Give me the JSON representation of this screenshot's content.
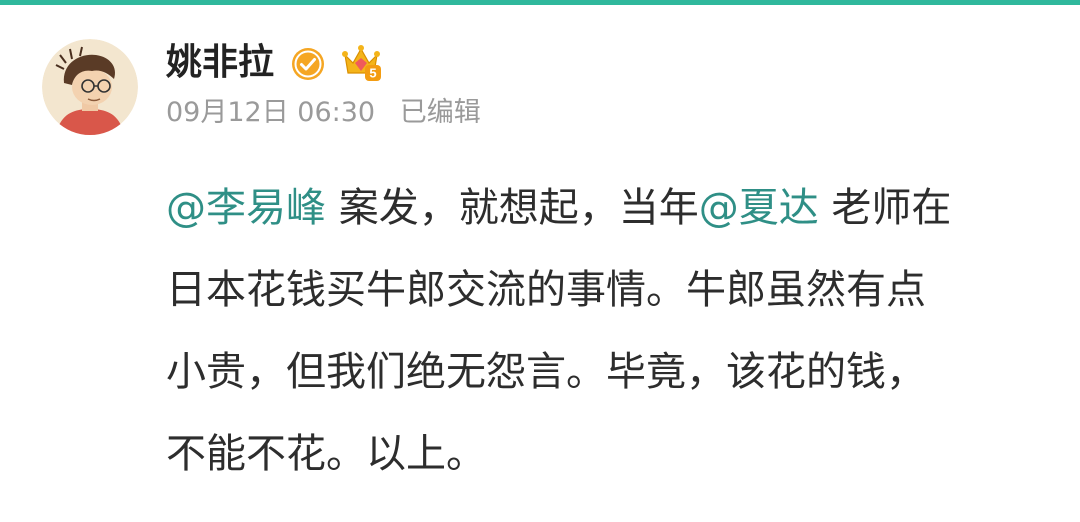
{
  "theme": {
    "accent_color": "#2fb89c",
    "mention_color": "#2f8f86",
    "text_color": "#2d2d2d",
    "meta_color": "#9a9a9a",
    "verified_color": "#f5a623",
    "crown_color": "#f4b41a"
  },
  "post": {
    "author": {
      "name": "姚非拉",
      "avatar_icon": "cartoon-portrait-avatar",
      "verified_icon": "verified-badge-icon",
      "vip_icon": "vip-crown-icon",
      "vip_level": "5"
    },
    "meta": {
      "timestamp": "09月12日 06:30",
      "edited_label": "已编辑"
    },
    "content": {
      "line1": {
        "mention1": "@李易峰",
        "text1": " 案发，就想起，当年",
        "mention2": "@夏达",
        "text2": " 老师在"
      },
      "line2": "日本花钱买牛郎交流的事情。牛郎虽然有点",
      "line3": "小贵，但我们绝无怨言。毕竟，该花的钱，",
      "line4": "不能不花。以上。"
    }
  }
}
